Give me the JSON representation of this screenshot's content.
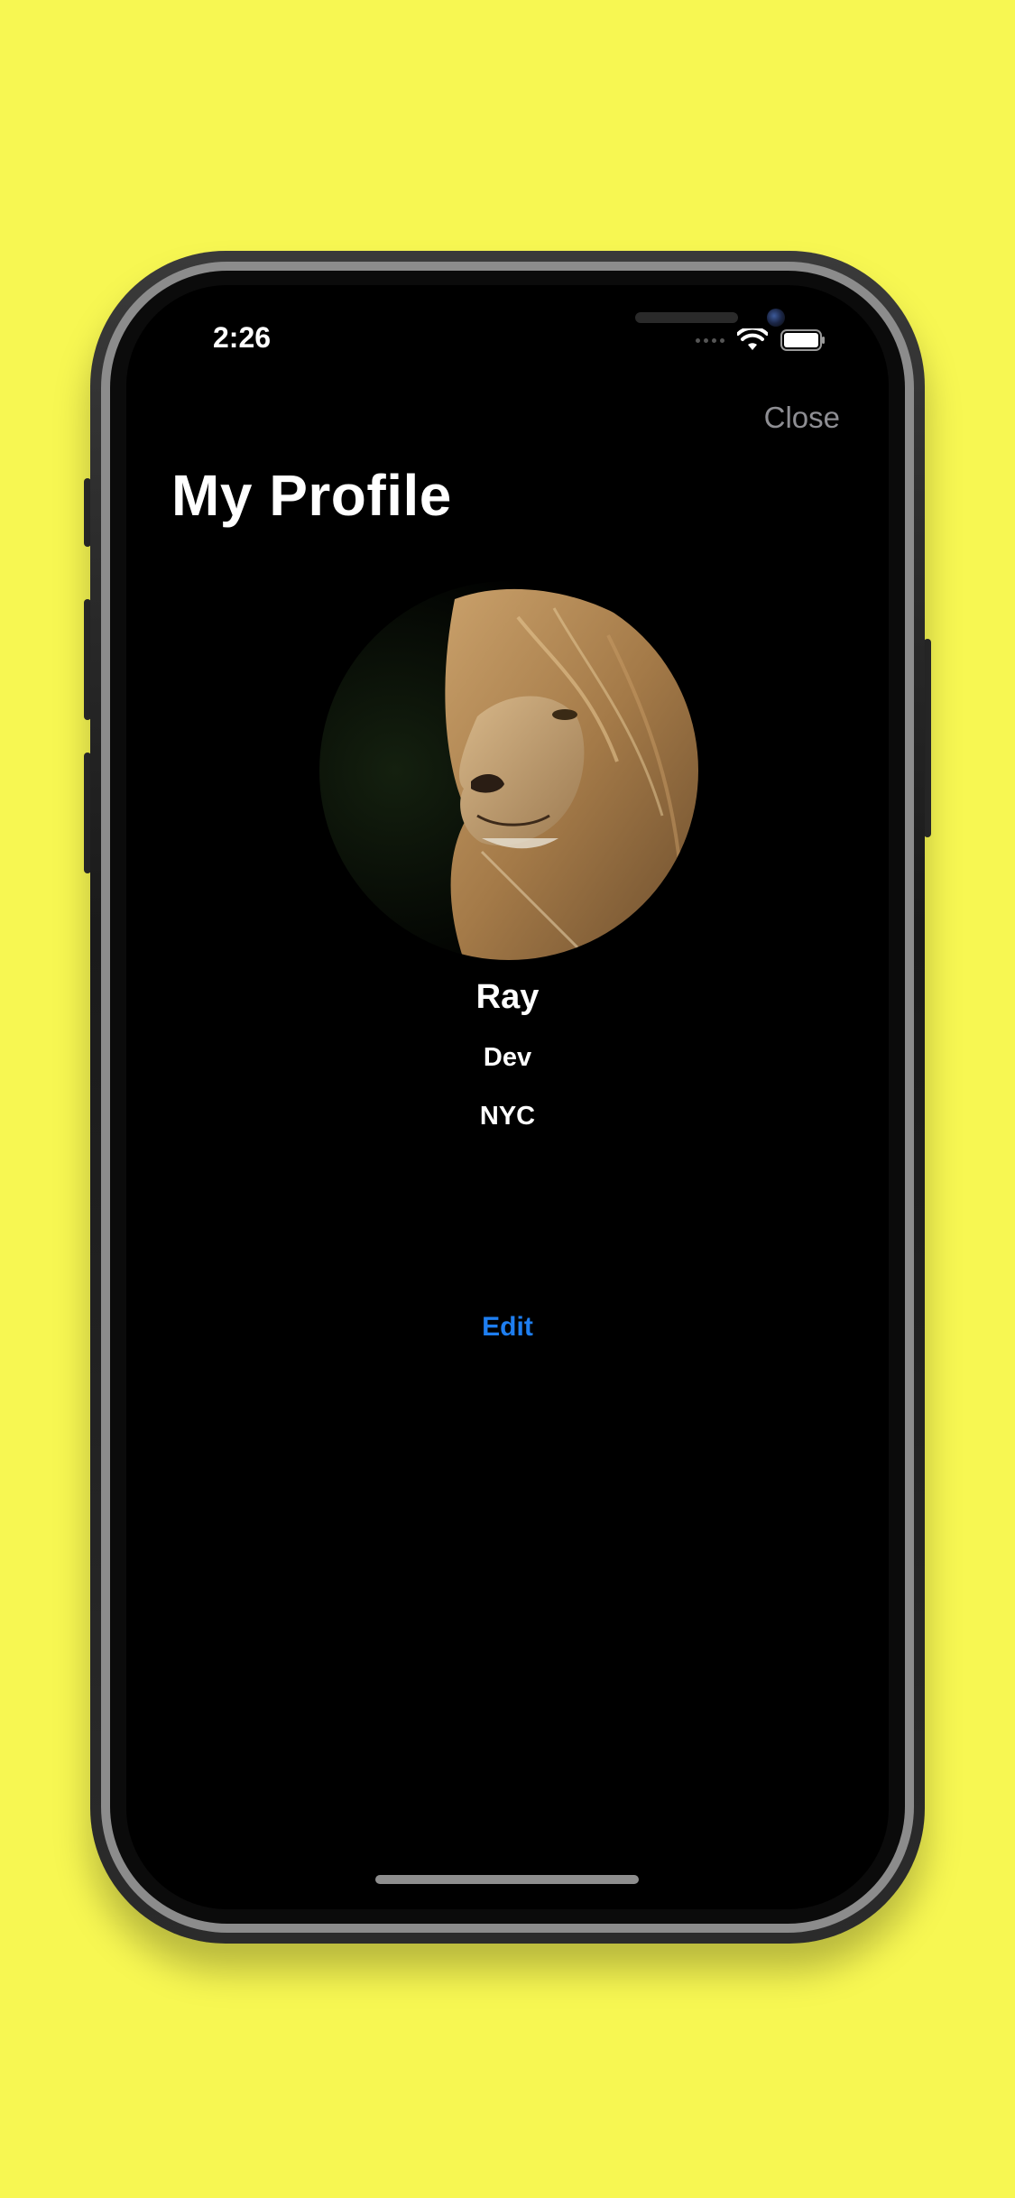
{
  "status_bar": {
    "time": "2:26",
    "signal_icon": "cellular-signal-icon",
    "wifi_icon": "wifi-icon",
    "battery_icon": "battery-icon"
  },
  "nav": {
    "close_label": "Close",
    "title": "My Profile"
  },
  "profile": {
    "avatar_icon": "lion-photo",
    "name": "Ray",
    "role": "Dev",
    "location": "NYC",
    "edit_label": "Edit"
  },
  "colors": {
    "background": "#f7f752",
    "screen": "#000000",
    "accent": "#1e7ef0",
    "close_text": "#8e8e93",
    "primary_text": "#ffffff"
  }
}
